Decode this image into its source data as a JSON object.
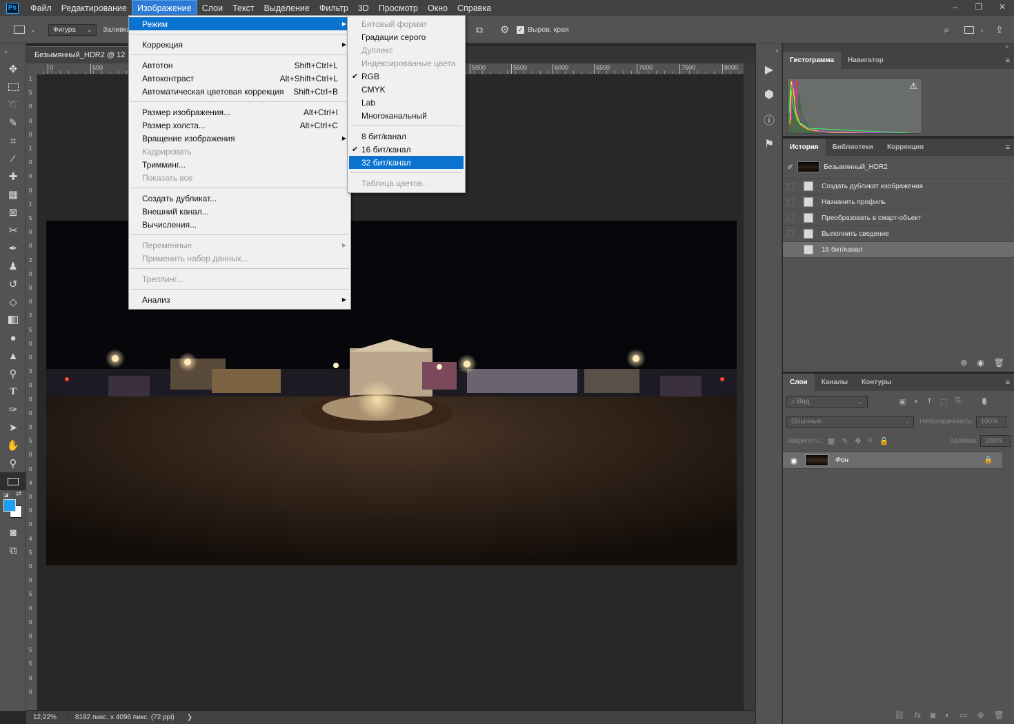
{
  "app": {
    "logo": "Ps"
  },
  "menubar": {
    "items": [
      "Файл",
      "Редактирование",
      "Изображение",
      "Слои",
      "Текст",
      "Выделение",
      "Фильтр",
      "3D",
      "Просмотр",
      "Окно",
      "Справка"
    ],
    "active_index": 2
  },
  "window_controls": {
    "minimize": "‒",
    "restore": "❐",
    "close": "✕"
  },
  "options": {
    "shape_label": "Фигура",
    "fill_label": "Заливка:",
    "align_edges": "Выров. края"
  },
  "doc": {
    "tab_title": "Безымянный_HDR2 @ 12"
  },
  "ruler": {
    "top": [
      "0",
      "500",
      "5000",
      "5500",
      "6000",
      "6500",
      "7000",
      "7500",
      "8000"
    ],
    "left": [
      "1",
      "5",
      "0",
      "0",
      "0",
      "1",
      "0",
      "0",
      "0",
      "1",
      "5",
      "0",
      "0",
      "2",
      "0",
      "0",
      "0",
      "2",
      "5",
      "0",
      "0",
      "3",
      "0",
      "0",
      "0",
      "3",
      "5",
      "0",
      "0",
      "4",
      "0",
      "0",
      "0",
      "4",
      "5",
      "0",
      "0",
      "5",
      "0",
      "0",
      "0",
      "5",
      "5",
      "0",
      "0"
    ]
  },
  "status": {
    "zoom": "12,22%",
    "info": "8192 пикс. x 4096 пикс. (72 ppi)",
    "arrow": "❯"
  },
  "image_menu": {
    "groups": [
      [
        {
          "label": "Режим",
          "submenu": true,
          "highlighted": true
        }
      ],
      [
        {
          "label": "Коррекция",
          "submenu": true
        }
      ],
      [
        {
          "label": "Автотон",
          "shortcut": "Shift+Ctrl+L"
        },
        {
          "label": "Автоконтраст",
          "shortcut": "Alt+Shift+Ctrl+L"
        },
        {
          "label": "Автоматическая цветовая коррекция",
          "shortcut": "Shift+Ctrl+B"
        }
      ],
      [
        {
          "label": "Размер изображения...",
          "shortcut": "Alt+Ctrl+I"
        },
        {
          "label": "Размер холста...",
          "shortcut": "Alt+Ctrl+C"
        },
        {
          "label": "Вращение изображения",
          "submenu": true
        },
        {
          "label": "Кадрировать",
          "disabled": true
        },
        {
          "label": "Тримминг..."
        },
        {
          "label": "Показать все",
          "disabled": true
        }
      ],
      [
        {
          "label": "Создать дубликат..."
        },
        {
          "label": "Внешний канал..."
        },
        {
          "label": "Вычисления..."
        }
      ],
      [
        {
          "label": "Переменные",
          "submenu": true,
          "disabled": true
        },
        {
          "label": "Применить набор данных...",
          "disabled": true
        }
      ],
      [
        {
          "label": "Треппинг...",
          "disabled": true
        }
      ],
      [
        {
          "label": "Анализ",
          "submenu": true
        }
      ]
    ]
  },
  "mode_menu": {
    "groups": [
      [
        {
          "label": "Битовый формат",
          "disabled": true
        },
        {
          "label": "Градации серого"
        },
        {
          "label": "Дуплекс",
          "disabled": true
        },
        {
          "label": "Индексированные цвета",
          "disabled": true
        },
        {
          "label": "RGB",
          "checked": true
        },
        {
          "label": "CMYK"
        },
        {
          "label": "Lab"
        },
        {
          "label": "Многоканальный"
        }
      ],
      [
        {
          "label": "8 бит/канал"
        },
        {
          "label": "16 бит/канал",
          "checked": true
        },
        {
          "label": "32 бит/канал",
          "highlighted": true
        }
      ],
      [
        {
          "label": "Таблица цветов...",
          "disabled": true
        }
      ]
    ]
  },
  "histogram_panel": {
    "tabs": [
      "Гистограмма",
      "Навигатор"
    ],
    "warning_icon": "⚠"
  },
  "history_panel": {
    "tabs": [
      "История",
      "Библиотеки",
      "Коррекция"
    ],
    "snapshot": "Безымянный_HDR2",
    "states": [
      "Создать дубликат изображения",
      "Назначить профиль",
      "Преобразовать в смарт-объект",
      "Выполнить сведение",
      "16 бит/канал"
    ]
  },
  "layers_panel": {
    "tabs": [
      "Слои",
      "Каналы",
      "Контуры"
    ],
    "filter_placeholder": "Вид",
    "blend_mode": "Обычные",
    "opacity_label": "Непрозрачность:",
    "opacity_value": "100%",
    "lock_label": "Закрепить:",
    "fill_label": "Заливка:",
    "fill_value": "100%",
    "layer_name": "Фон"
  },
  "colors": {
    "accent": "#0a72cf",
    "foreground": "#1da1f2",
    "background": "#ffffff"
  }
}
